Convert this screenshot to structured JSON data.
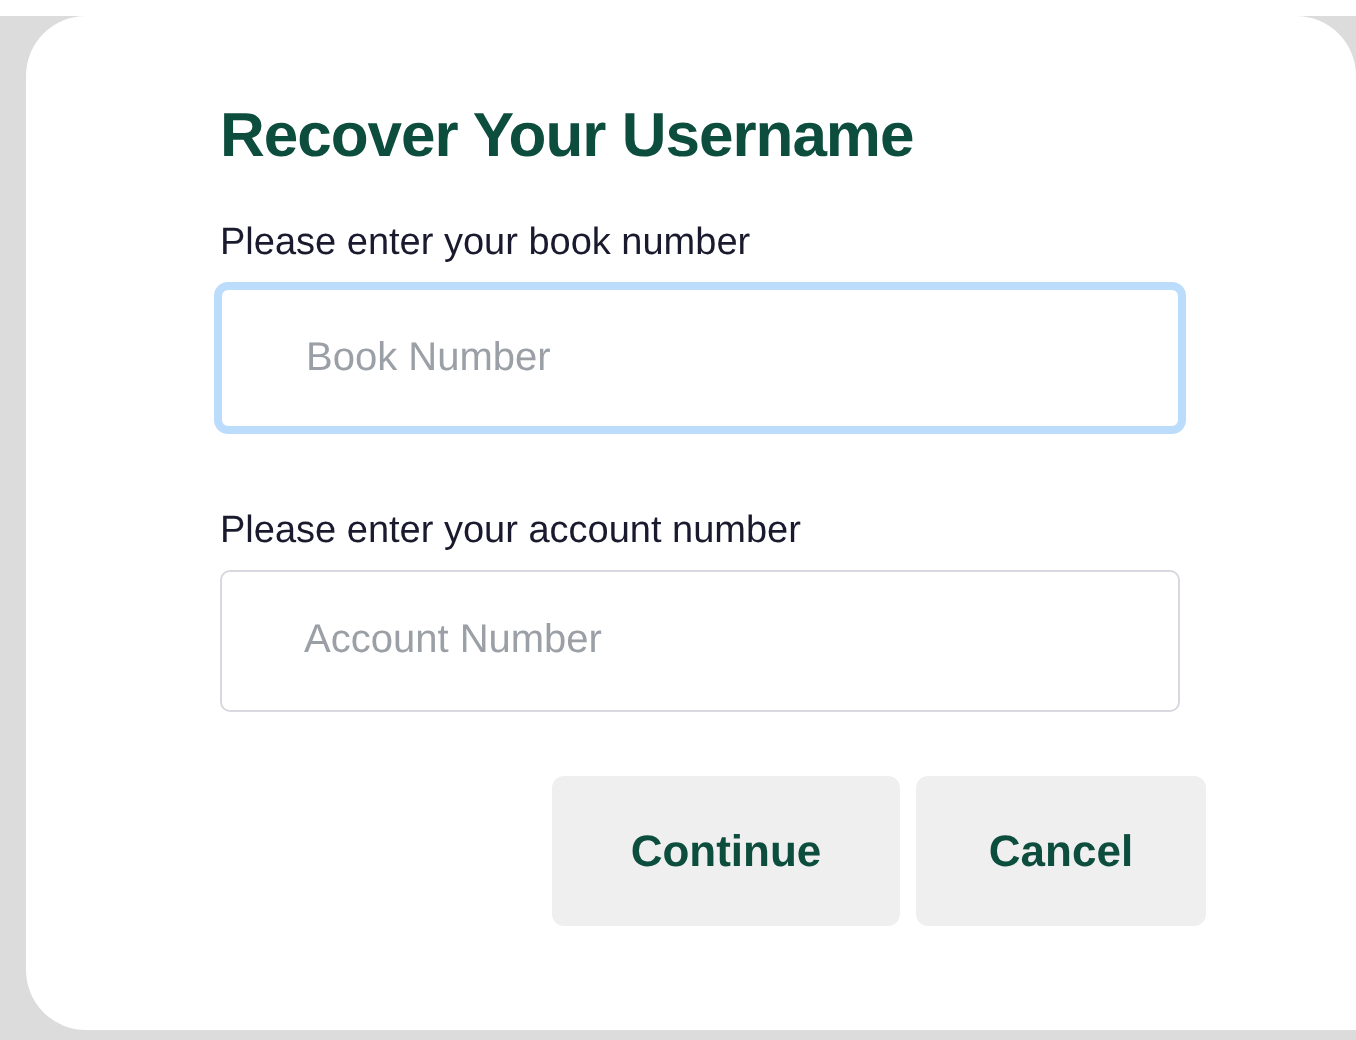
{
  "title": "Recover Your Username",
  "fields": [
    {
      "label": "Please enter your book number",
      "placeholder": "Book Number",
      "focused": true
    },
    {
      "label": "Please enter your account number",
      "placeholder": "Account Number",
      "focused": false
    }
  ],
  "buttons": [
    "Continue",
    "Cancel"
  ]
}
